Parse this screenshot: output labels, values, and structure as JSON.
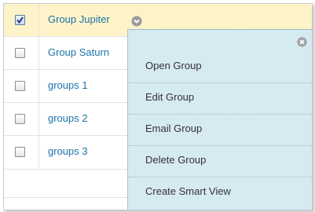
{
  "groups": [
    {
      "name": "Group Jupiter",
      "checked": true
    },
    {
      "name": "Group Saturn",
      "checked": false
    },
    {
      "name": "groups 1",
      "checked": false
    },
    {
      "name": "groups 2",
      "checked": false
    },
    {
      "name": "groups 3",
      "checked": false
    }
  ],
  "menu": {
    "items": [
      "Open Group",
      "Edit Group",
      "Email Group",
      "Delete Group",
      "Create Smart View"
    ],
    "close_icon": "close-circle-icon",
    "chevron_icon": "chevron-down-circle-icon"
  },
  "colors": {
    "link": "#1e73a8",
    "selected_row": "#fdf3c8",
    "menu_bg": "#d6eaf2"
  }
}
